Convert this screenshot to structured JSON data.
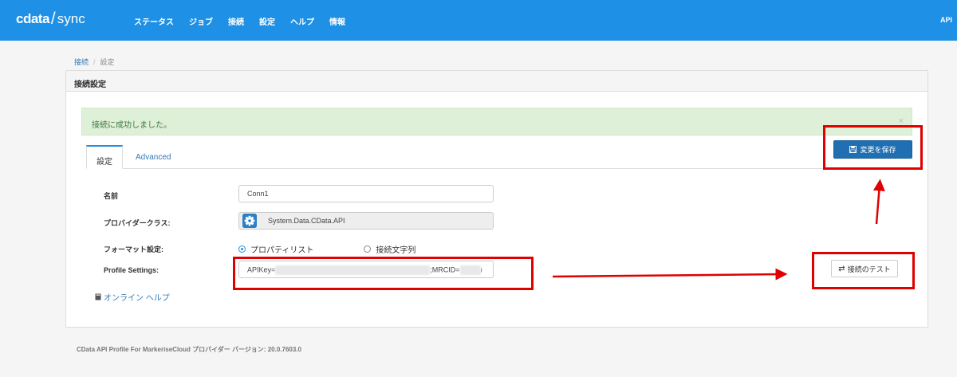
{
  "header": {
    "logo_brand": "cdata",
    "logo_product": "sync",
    "nav": [
      "ステータス",
      "ジョブ",
      "接続",
      "設定",
      "ヘルプ",
      "情報"
    ],
    "api_label": "API",
    "bg_color": "#1e90e6"
  },
  "breadcrumb": {
    "link": "接続",
    "separator": "/",
    "current": "設定"
  },
  "panel": {
    "title": "接続設定",
    "alert": {
      "message": "接続に成功しました。",
      "close": "×"
    },
    "tabs": [
      {
        "label": "設定",
        "active": true
      },
      {
        "label": "Advanced",
        "active": false
      }
    ],
    "form": {
      "name_label": "名前",
      "name_value": "Conn1",
      "provider_label": "プロバイダークラス:",
      "provider_value": "System.Data.CData.API",
      "format_label": "フォーマット設定:",
      "format_options": [
        {
          "label": "プロパティリスト",
          "checked": true
        },
        {
          "label": "接続文字列",
          "checked": false
        }
      ],
      "profile_label": "Profile Settings:",
      "profile_prefix": "APIKey=",
      "profile_mid": ";MRCID=",
      "profile_tail": "ı"
    },
    "help_link": "オンライン ヘルプ",
    "save_button": "変更を保存",
    "test_button": "接続のテスト"
  },
  "footer": "CData API Profile For MarkeriseCloud プロバイダー バージョン: 20.0.7603.0",
  "annotation_color": "#e00000"
}
